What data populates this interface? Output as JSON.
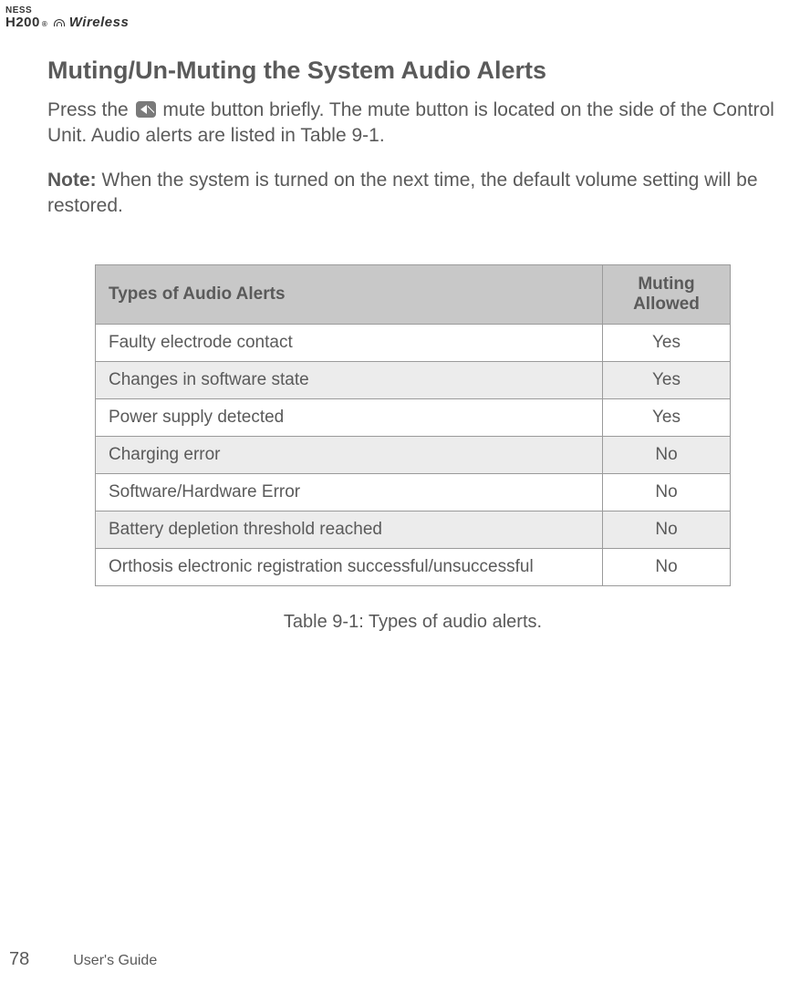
{
  "logo": {
    "line1": "NESS",
    "line2_a": "H200",
    "line2_b": "Wireless",
    "reg": "®"
  },
  "section": {
    "title": "Muting/Un-Muting the System Audio Alerts",
    "para1_a": "Press the ",
    "para1_b": " mute button briefly. The mute button is located on the side of the Control Unit. Audio alerts are listed in Table 9-1.",
    "note_label": "Note:",
    "note_text": " When the system is turned on the next time, the default volume setting will be restored."
  },
  "table": {
    "header_col1": "Types of Audio Alerts",
    "header_col2": "Muting Allowed",
    "rows": [
      {
        "type": "Faulty electrode contact",
        "muting": "Yes"
      },
      {
        "type": "Changes in software state",
        "muting": "Yes"
      },
      {
        "type": "Power supply detected",
        "muting": "Yes"
      },
      {
        "type": "Charging error",
        "muting": "No"
      },
      {
        "type": "Software/Hardware Error",
        "muting": "No"
      },
      {
        "type": "Battery depletion threshold reached",
        "muting": "No"
      },
      {
        "type": "Orthosis electronic registration successful/unsuccessful",
        "muting": "No"
      }
    ],
    "caption": "Table 9-1: Types of audio alerts."
  },
  "footer": {
    "page": "78",
    "guide": "User's Guide"
  }
}
